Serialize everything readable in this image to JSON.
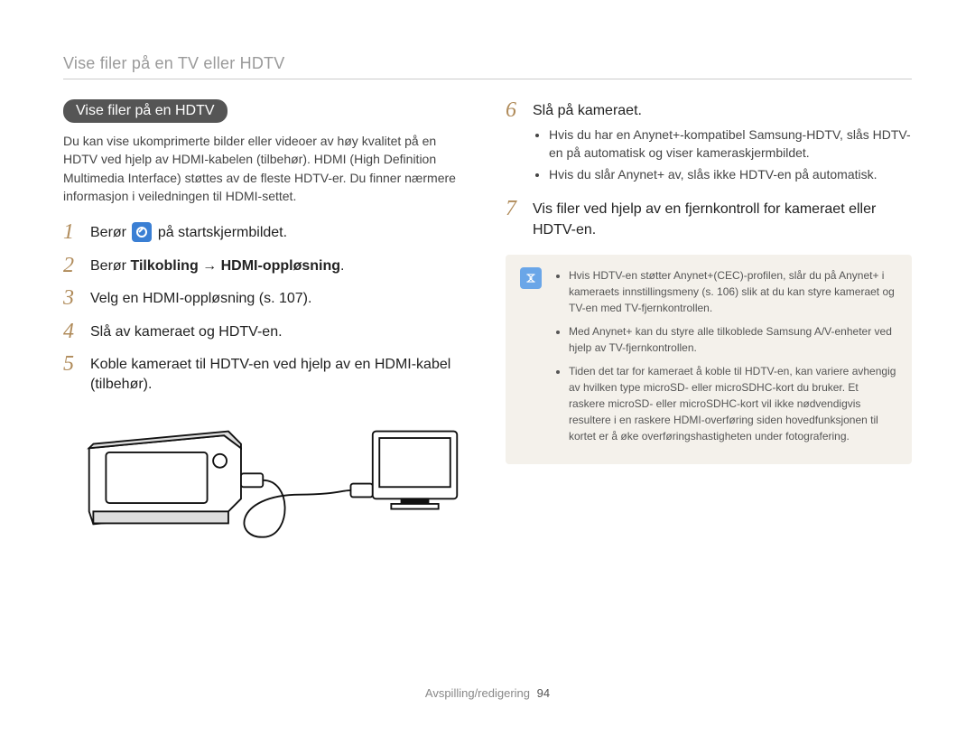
{
  "header": {
    "title": "Vise filer på en TV eller HDTV"
  },
  "left": {
    "section_heading": "Vise filer på en HDTV",
    "intro": "Du kan vise ukomprimerte bilder eller videoer av høy kvalitet på en HDTV ved hjelp av HDMI-kabelen (tilbehør). HDMI (High Definition Multimedia Interface) støttes av de fleste HDTV-er. Du finner nærmere informasjon i veiledningen til HDMI-settet.",
    "steps": {
      "s1": {
        "num": "1",
        "pre": "Berør",
        "post": "på startskjermbildet."
      },
      "s2": {
        "num": "2",
        "pre": "Berør ",
        "bold": "Tilkobling → HDMI-oppløsning",
        "post": "."
      },
      "s3": {
        "num": "3",
        "text": "Velg en HDMI-oppløsning (s. 107)."
      },
      "s4": {
        "num": "4",
        "text": "Slå av kameraet og HDTV-en."
      },
      "s5": {
        "num": "5",
        "text": "Koble kameraet til HDTV-en ved hjelp av en HDMI-kabel (tilbehør)."
      }
    }
  },
  "right": {
    "steps": {
      "s6": {
        "num": "6",
        "text": "Slå på kameraet.",
        "bullets": [
          "Hvis du har en Anynet+-kompatibel Samsung-HDTV, slås HDTV-en på automatisk og viser kameraskjermbildet.",
          "Hvis du slår Anynet+ av, slås ikke HDTV-en på automatisk."
        ]
      },
      "s7": {
        "num": "7",
        "text": "Vis filer ved hjelp av en fjernkontroll for kameraet eller HDTV-en."
      }
    },
    "note": {
      "items": [
        "Hvis HDTV-en støtter Anynet+(CEC)-profilen, slår du på Anynet+ i kameraets innstillingsmeny (s. 106) slik at du kan styre kameraet og TV-en med TV-fjernkontrollen.",
        "Med Anynet+ kan du styre alle tilkoblede Samsung A/V-enheter ved hjelp av TV-fjernkontrollen.",
        "Tiden det tar for kameraet å koble til HDTV-en, kan variere avhengig av hvilken type microSD- eller microSDHC-kort du bruker. Et raskere microSD- eller microSDHC-kort vil ikke nødvendigvis resultere i en raskere HDMI-overføring siden hovedfunksjonen til kortet er å øke overføringshastigheten under fotografering."
      ]
    }
  },
  "footer": {
    "section": "Avspilling/redigering",
    "page": "94"
  }
}
